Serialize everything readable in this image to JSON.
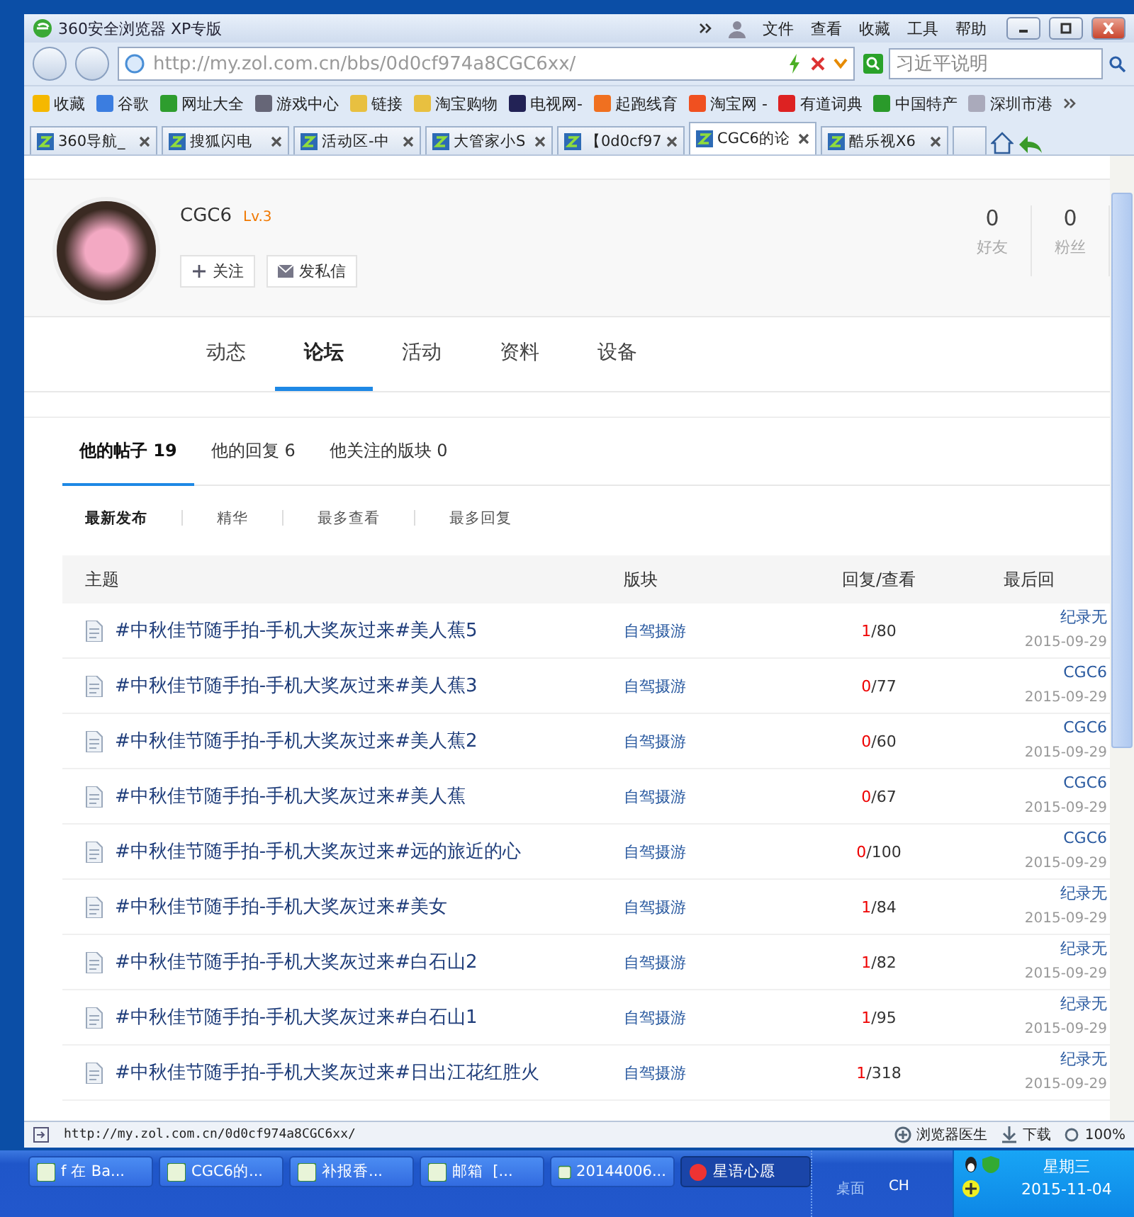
{
  "window": {
    "title": "360安全浏览器 XP专版",
    "menu": [
      "文件",
      "查看",
      "收藏",
      "工具",
      "帮助"
    ]
  },
  "address_bar": {
    "url": "http://my.zol.com.cn/bbs/0d0cf974a8CGC6xx/"
  },
  "search": {
    "placeholder": "习近平说明"
  },
  "bookmarks": [
    "收藏",
    "谷歌",
    "网址大全",
    "游戏中心",
    "链接",
    "淘宝购物",
    "电视网-",
    "起跑线育",
    "淘宝网 -",
    "有道词典",
    "中国特产",
    "深圳市港"
  ],
  "tabs": [
    {
      "label": "360导航_",
      "selected": false
    },
    {
      "label": "搜狐闪电",
      "selected": false
    },
    {
      "label": "活动区-中",
      "selected": false
    },
    {
      "label": "大管家小S",
      "selected": false
    },
    {
      "label": "【0d0cf97",
      "selected": false
    },
    {
      "label": "CGC6的论",
      "selected": true
    },
    {
      "label": "酷乐视X6",
      "selected": false
    }
  ],
  "profile": {
    "name": "CGC6",
    "level": "Lv.3",
    "buttons": [
      "关注",
      "发私信"
    ],
    "stats": [
      {
        "value": "0",
        "label": "好友"
      },
      {
        "value": "0",
        "label": "粉丝"
      }
    ]
  },
  "nav": [
    {
      "label": "动态",
      "selected": false
    },
    {
      "label": "论坛",
      "selected": true
    },
    {
      "label": "活动",
      "selected": false
    },
    {
      "label": "资料",
      "selected": false
    },
    {
      "label": "设备",
      "selected": false
    }
  ],
  "subtabs": [
    {
      "label": "他的帖子",
      "count": "19",
      "selected": true
    },
    {
      "label": "他的回复",
      "count": "6",
      "selected": false
    },
    {
      "label": "他关注的版块",
      "count": "0",
      "selected": false
    }
  ],
  "filters": [
    {
      "label": "最新发布",
      "selected": true
    },
    {
      "label": "精华",
      "selected": false
    },
    {
      "label": "最多查看",
      "selected": false
    },
    {
      "label": "最多回复",
      "selected": false
    }
  ],
  "table": {
    "columns": [
      "主题",
      "版块",
      "回复/查看",
      "最后回"
    ],
    "rows": [
      {
        "title": "#中秋佳节随手拍-手机大奖灰过来#美人蕉5",
        "board": "自驾摄游",
        "counts": "1/80",
        "last_user": "纪录无",
        "date": "2015-09-29"
      },
      {
        "title": "#中秋佳节随手拍-手机大奖灰过来#美人蕉3",
        "board": "自驾摄游",
        "counts": "0/77",
        "last_user": "CGC6",
        "date": "2015-09-29"
      },
      {
        "title": "#中秋佳节随手拍-手机大奖灰过来#美人蕉2",
        "board": "自驾摄游",
        "counts": "0/60",
        "last_user": "CGC6",
        "date": "2015-09-29"
      },
      {
        "title": "#中秋佳节随手拍-手机大奖灰过来#美人蕉",
        "board": "自驾摄游",
        "counts": "0/67",
        "last_user": "CGC6",
        "date": "2015-09-29"
      },
      {
        "title": "#中秋佳节随手拍-手机大奖灰过来#远的旅近的心",
        "board": "自驾摄游",
        "counts": "0/100",
        "last_user": "CGC6",
        "date": "2015-09-29"
      },
      {
        "title": "#中秋佳节随手拍-手机大奖灰过来#美女",
        "board": "自驾摄游",
        "counts": "1/84",
        "last_user": "纪录无",
        "date": "2015-09-29"
      },
      {
        "title": "#中秋佳节随手拍-手机大奖灰过来#白石山2",
        "board": "自驾摄游",
        "counts": "1/82",
        "last_user": "纪录无",
        "date": "2015-09-29"
      },
      {
        "title": "#中秋佳节随手拍-手机大奖灰过来#白石山1",
        "board": "自驾摄游",
        "counts": "1/95",
        "last_user": "纪录无",
        "date": "2015-09-29"
      },
      {
        "title": "#中秋佳节随手拍-手机大奖灰过来#日出江花红胜火",
        "board": "自驾摄游",
        "counts": "1/318",
        "last_user": "纪录无",
        "date": "2015-09-29"
      }
    ]
  },
  "status_bar": {
    "url": "http://my.zol.com.cn/0d0cf974a8CGC6xx/",
    "items": [
      "浏览器医生",
      "下载"
    ],
    "zoom": "100%"
  },
  "taskbar": {
    "items": [
      {
        "label": "f 在 Ba...",
        "selected": false
      },
      {
        "label": "CGC6的...",
        "selected": false
      },
      {
        "label": "补报香...",
        "selected": false
      },
      {
        "label": "邮箱  [...",
        "selected": false
      },
      {
        "label": "20144006...",
        "selected": false
      },
      {
        "label": "星语心愿",
        "selected": true
      }
    ],
    "desktop": "桌面",
    "language": "CH",
    "weekday": "星期三",
    "date": "2015-11-04"
  }
}
